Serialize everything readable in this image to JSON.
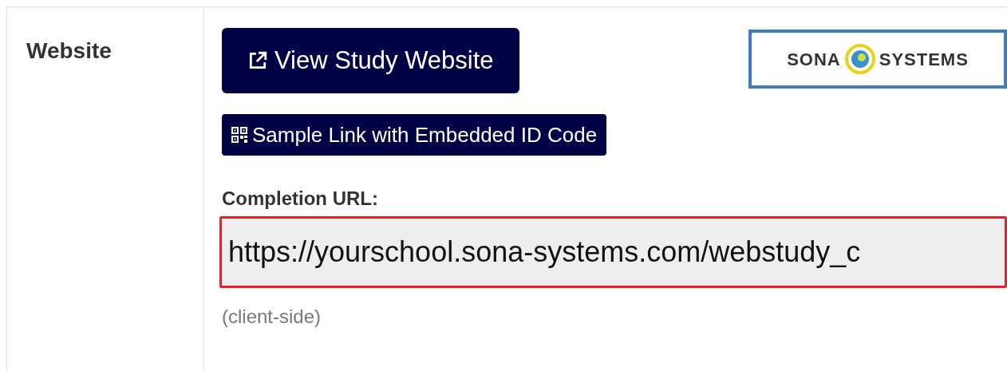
{
  "row": {
    "label": "Website"
  },
  "buttons": [
    {
      "kind": "external",
      "label": "View Study Website"
    },
    {
      "kind": "qr",
      "label": "Sample Link with Embedded ID Code"
    }
  ],
  "logo": {
    "left": "SONA",
    "right": "SYSTEMS"
  },
  "completion": {
    "label": "Completion URL:",
    "value": "https://yourschool.sona-systems.com/webstudy_c",
    "highlighted": true,
    "note": "(client-side)"
  }
}
